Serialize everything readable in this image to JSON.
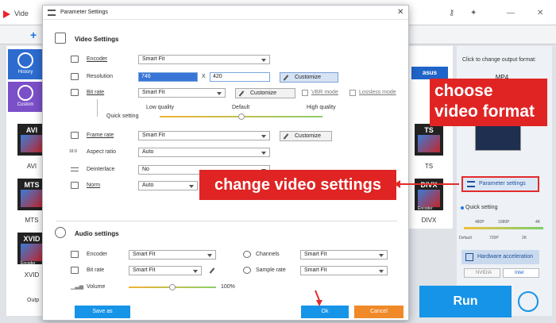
{
  "app": {
    "title_partial": "Vide",
    "plus": "+",
    "sidebar": {
      "history": "History",
      "custom": "Custom"
    },
    "formats_left": [
      "AVI",
      "MTS",
      "XVID"
    ],
    "formats_right": [
      "TS",
      "DIVX"
    ],
    "encoder_badge": "Encoder",
    "band_text": "asus",
    "output_label": "Outp",
    "output_panel": {
      "label": "Click to change output format:",
      "format": "MP4",
      "param_button": "Parameter settings",
      "quick_setting": "Quick setting",
      "ticks_top": [
        "480P",
        "1080P",
        "4K"
      ],
      "ticks_bottom": [
        "Default",
        "720P",
        "2K"
      ],
      "hw_button": "Hardware acceleration",
      "gpu1": "NVIDIA",
      "gpu2": "Intel",
      "run": "Run"
    }
  },
  "dialog": {
    "title": "Parameter Settings",
    "video_heading": "Video Settings",
    "encoder": {
      "label": "Encoder",
      "value": "Smart Fit"
    },
    "resolution": {
      "label": "Resolution",
      "width": "746",
      "sep": "X",
      "height": "420",
      "button": "Customize"
    },
    "bitrate": {
      "label": "Bit rate",
      "value": "Smart Fit",
      "button": "Customize",
      "vbr": "VBR mode",
      "lossless": "Lossless mode"
    },
    "quality": {
      "low": "Low quality",
      "default": "Default",
      "high": "High quality",
      "quick": "Quick setting",
      "level": 0.5
    },
    "framerate": {
      "label": "Frame rate",
      "value": "Smart Fit",
      "button": "Customize"
    },
    "aspect": {
      "label": "Aspect ratio",
      "value": "Auto"
    },
    "deinterlace": {
      "label": "Deinterlace",
      "value": "No"
    },
    "norm": {
      "label": "Norm",
      "value": "Auto"
    },
    "audio_heading": "Audio settings",
    "audio_encoder": {
      "label": "Encoder",
      "value": "Smart Fit"
    },
    "channels": {
      "label": "Channels",
      "value": "Smart Fit"
    },
    "audio_bitrate": {
      "label": "Bit rate",
      "value": "Smart Fit"
    },
    "sample_rate": {
      "label": "Sample rate",
      "value": "Smart Fit"
    },
    "volume": {
      "label": "Volume",
      "value": "100%",
      "level": 0.5
    },
    "save_as": "Save as",
    "ok": "Ok",
    "cancel": "Cancel"
  },
  "overlays": {
    "choose_line1": "choose",
    "choose_line2": "video format",
    "change": "change video settings"
  },
  "colors": {
    "accent": "#1694e8",
    "highlight": "#e02424",
    "cancel": "#f08a28"
  }
}
